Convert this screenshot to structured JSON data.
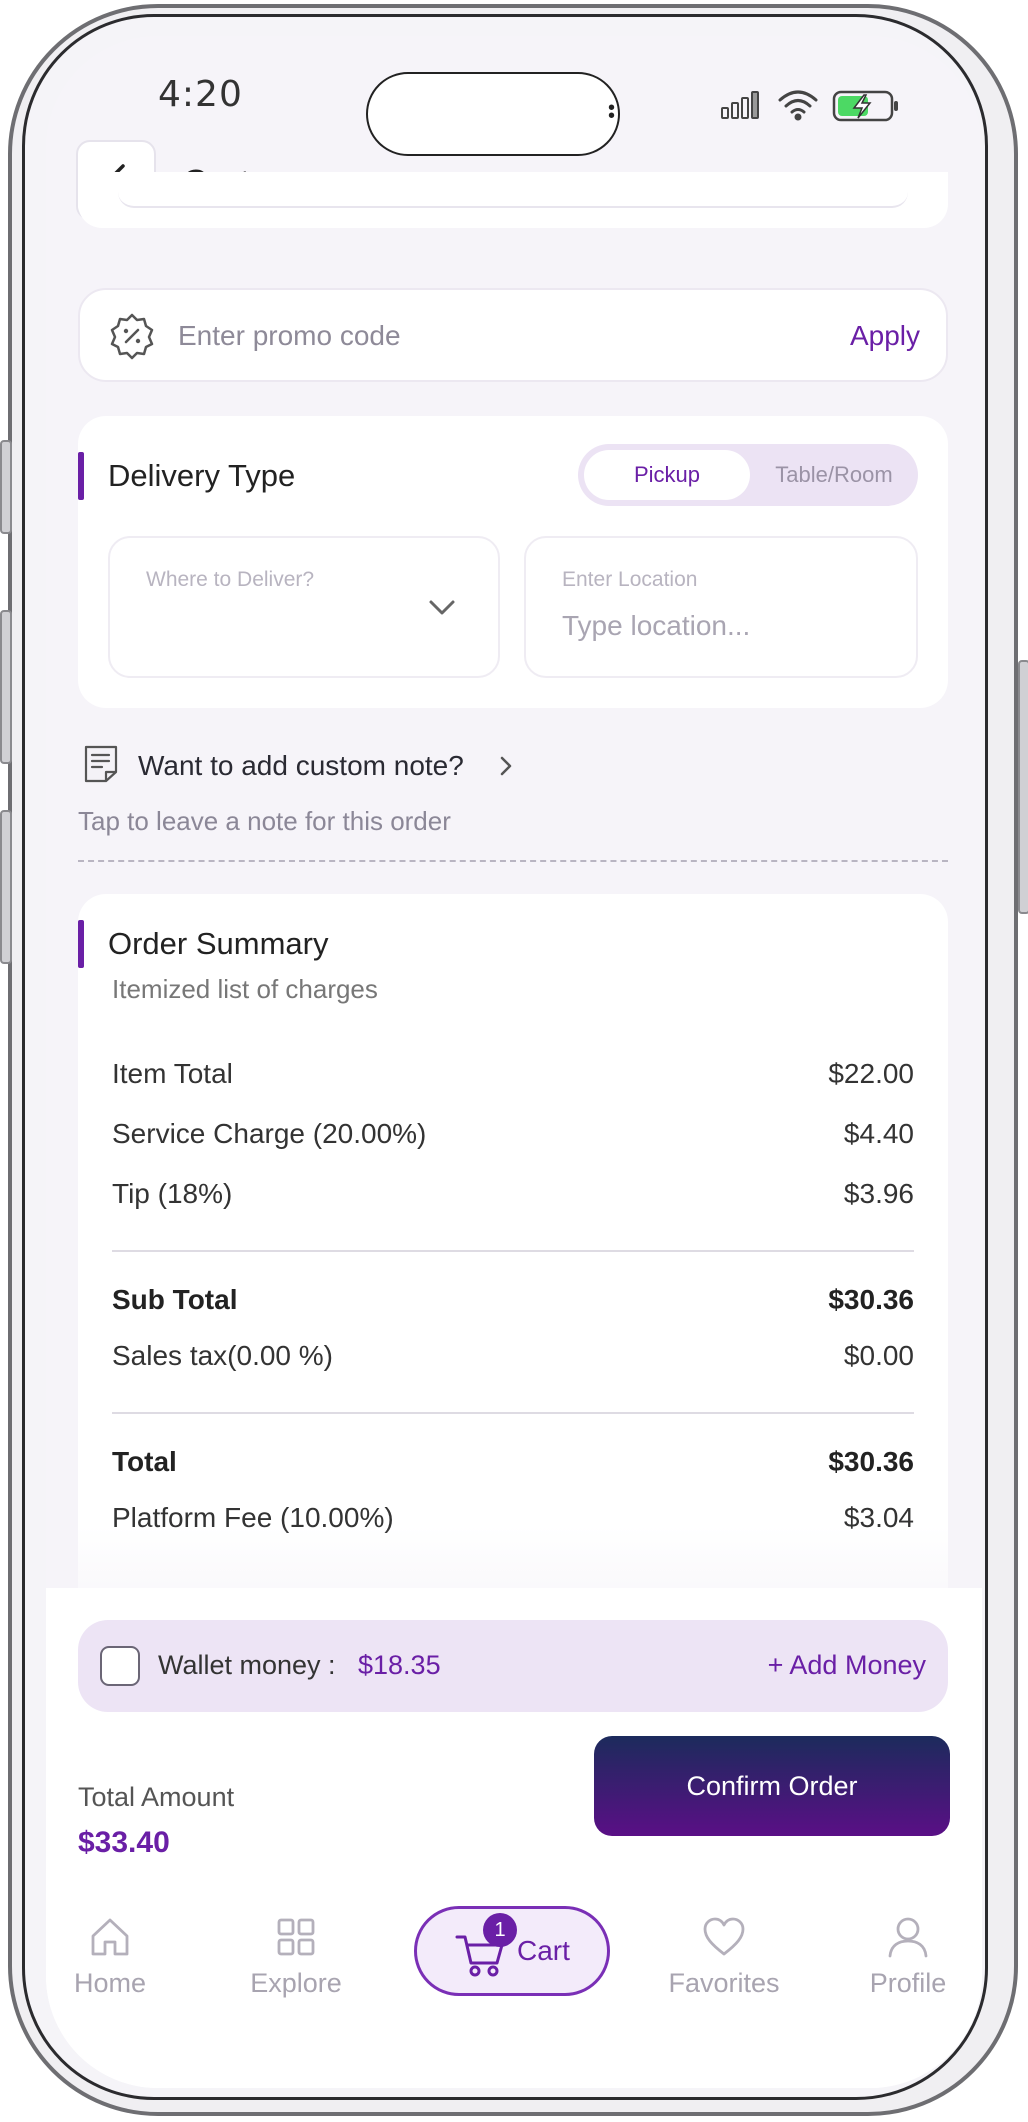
{
  "status_bar": {
    "time": "4:20"
  },
  "header": {
    "title": "Cart"
  },
  "promo": {
    "placeholder": "Enter promo code",
    "apply_label": "Apply"
  },
  "delivery": {
    "title": "Delivery Type",
    "options": [
      "Pickup",
      "Table/Room"
    ],
    "selected": "Pickup",
    "where_label": "Where to Deliver?",
    "location_label": "Enter Location",
    "location_placeholder": "Type location..."
  },
  "note": {
    "title": "Want to add custom note?",
    "subtitle": "Tap to leave a note for this order"
  },
  "summary": {
    "title": "Order Summary",
    "subtitle": "Itemized list of charges",
    "rows": [
      {
        "label": "Item Total",
        "value": "$22.00"
      },
      {
        "label": "Service Charge (20.00%)",
        "value": "$4.40"
      },
      {
        "label": "Tip (18%)",
        "value": "$3.96"
      }
    ],
    "subtotal": {
      "label": "Sub Total",
      "value": "$30.36"
    },
    "tax": {
      "label": "Sales tax(0.00 %)",
      "value": "$0.00"
    },
    "total": {
      "label": "Total",
      "value": "$30.36"
    },
    "platform_fee": {
      "label": "Platform Fee (10.00%)",
      "value": "$3.04"
    }
  },
  "wallet": {
    "label": "Wallet money :",
    "amount": "$18.35",
    "add_label": "+ Add Money",
    "checked": false
  },
  "checkout": {
    "total_label": "Total Amount",
    "total_value": "$33.40",
    "confirm_label": "Confirm Order"
  },
  "nav": {
    "items": [
      {
        "label": "Home",
        "icon": "home-icon"
      },
      {
        "label": "Explore",
        "icon": "grid-icon"
      },
      {
        "label": "Cart",
        "icon": "cart-icon",
        "badge": "1",
        "active": true
      },
      {
        "label": "Favorites",
        "icon": "heart-icon"
      },
      {
        "label": "Profile",
        "icon": "user-icon"
      }
    ]
  },
  "colors": {
    "accent": "#6a1fa6",
    "button_gradient_top": "#1c2b5c",
    "button_gradient_bottom": "#5a0f86",
    "wallet_bg": "#ede4f5"
  }
}
